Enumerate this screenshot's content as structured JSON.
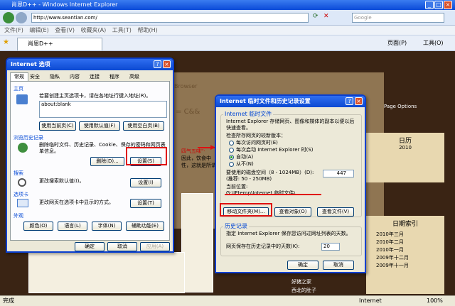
{
  "window": {
    "title": "肖恩D++ - Windows Internet Explorer"
  },
  "address": {
    "url": "http://www.seantian.com/",
    "search_placeholder": "Google"
  },
  "menubar": {
    "items": [
      "文件(F)",
      "编辑(E)",
      "查看(V)",
      "收藏夹(A)",
      "工具(T)",
      "帮助(H)"
    ]
  },
  "tabbar": {
    "tab": "肖恩D++",
    "page_btn": "页面(P)",
    "tools_btn": "工具(O)"
  },
  "page": {
    "browser_text": "Browser",
    "page_options": "Page Options",
    "calendar_title": "日历",
    "calendar_year": "2010",
    "archive_title": "日期索引",
    "archive_items": [
      "2010年三月",
      "2010年二月",
      "2010年一月",
      "2009年十二月",
      "2009年十一月"
    ],
    "snippet1": "四气五味\"·",
    "snippet2": "因此，饮食中",
    "snippet3": "性，这就是所谓",
    "snippet4": "&  I = C&&",
    "list1": "好猪之家",
    "list2": "西北的肚子",
    "list3": "..."
  },
  "status": {
    "left": "完成",
    "zone": "Internet",
    "zoom": "100%"
  },
  "options": {
    "title": "Internet 选项",
    "tabs": [
      "常规",
      "安全",
      "隐私",
      "内容",
      "连接",
      "程序",
      "高级"
    ],
    "home": {
      "label": "主页",
      "desc": "若要创建主页选项卡，请在各地址行键入地址(R)。",
      "value": "about:blank",
      "btn_current": "使用当前页(C)",
      "btn_default": "使用默认值(F)",
      "btn_blank": "使用空白页(B)"
    },
    "history": {
      "label": "浏览历史记录",
      "desc": "删除临时文件、历史记录、Cookie、保存的密码和网页表单信息。",
      "btn_delete": "删除(D)...",
      "btn_settings": "设置(S)"
    },
    "search": {
      "label": "搜索",
      "desc": "更改搜索默认值(I)。",
      "btn": "设置(I)"
    },
    "tabs_section": {
      "label": "选项卡",
      "desc": "更改网页在选项卡中显示的方式。",
      "btn": "设置(T)"
    },
    "appearance": {
      "label": "外观",
      "btn_colors": "颜色(O)",
      "btn_lang": "语言(L)",
      "btn_fonts": "字体(N)",
      "btn_access": "辅助功能(E)"
    },
    "footer": {
      "ok": "确定",
      "cancel": "取消",
      "apply": "应用(A)"
    }
  },
  "tempfiles": {
    "title": "Internet 临时文件和历史记录设置",
    "section1": "Internet 临时文件",
    "desc": "Internet Explorer 存储网页、图像和媒体的副本以便以后快速查看。",
    "check_label": "检查所存网页的较新版本：",
    "options": [
      "每次访问网页时(E)",
      "每次启动 Internet Explorer 时(S)",
      "自动(A)",
      "从不(N)"
    ],
    "selected_index": 2,
    "disk_label": "要使用的磁盘空间（8 - 1024MB）(D):",
    "disk_note": "(推荐: 50 - 250MB)",
    "disk_value": "447",
    "location_label": "当前位置:",
    "location_value": "G:\\IEtemp\\Internet 临时文件\\",
    "btn_move": "移动文件夹(M)...",
    "btn_objects": "查看对象(O)",
    "btn_files": "查看文件(V)",
    "section2": "历史记录",
    "history_desc": "指定 Internet Explorer 保存您访问过网址列表的天数。",
    "days_label": "网页保存在历史记录中的天数(K):",
    "days_value": "20",
    "ok": "确定",
    "cancel": "取消"
  }
}
